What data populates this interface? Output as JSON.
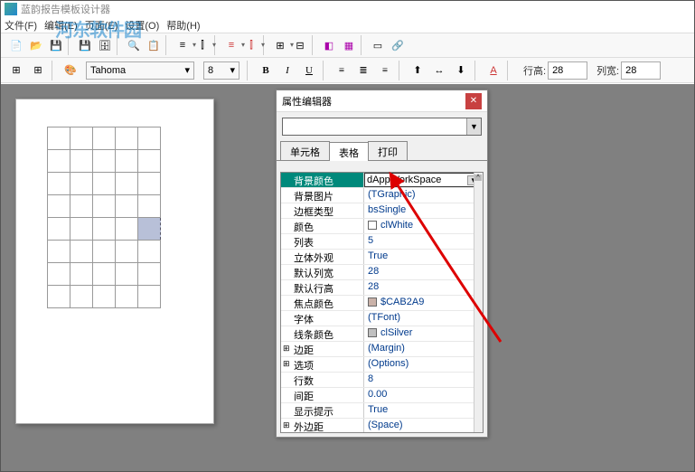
{
  "titlebar": {
    "title": "蓝韵报告模板设计器"
  },
  "menubar": {
    "items": [
      "文件(F)",
      "编辑(E)",
      "页面(E)",
      "设置(O)",
      "帮助(H)"
    ]
  },
  "watermark": "河东软件园",
  "font_toolbar": {
    "font_name": "Tahoma",
    "font_size": "8",
    "bold": "B",
    "italic": "I",
    "underline": "U",
    "row_height_label": "行高:",
    "row_height": "28",
    "col_width_label": "列宽:",
    "col_width": "28"
  },
  "prop_editor": {
    "title": "属性编辑器",
    "tabs": [
      "单元格",
      "表格",
      "打印"
    ],
    "active_tab": 1,
    "rows": [
      {
        "name": "背景颜色",
        "value": "dAppWorkSpace",
        "selected": true
      },
      {
        "name": "背景图片",
        "value": "(TGraphic)"
      },
      {
        "name": "边框类型",
        "value": "bsSingle"
      },
      {
        "name": "颜色",
        "value": "clWhite",
        "swatch": "#ffffff"
      },
      {
        "name": "列表",
        "value": "5"
      },
      {
        "name": "立体外观",
        "value": "True"
      },
      {
        "name": "默认列宽",
        "value": "28"
      },
      {
        "name": "默认行高",
        "value": "28"
      },
      {
        "name": "焦点颜色",
        "value": "$CAB2A9",
        "swatch": "#CAB2A9"
      },
      {
        "name": "字体",
        "value": "(TFont)"
      },
      {
        "name": "线条颜色",
        "value": "clSilver",
        "swatch": "#c0c0c0"
      },
      {
        "name": "边距",
        "value": "(Margin)",
        "expandable": true
      },
      {
        "name": "选项",
        "value": "(Options)",
        "expandable": true
      },
      {
        "name": "行数",
        "value": "8"
      },
      {
        "name": "间距",
        "value": "0.00"
      },
      {
        "name": "显示提示",
        "value": "True"
      },
      {
        "name": "外边距",
        "value": "(Space)",
        "expandable": true
      }
    ]
  },
  "chart_data": null
}
